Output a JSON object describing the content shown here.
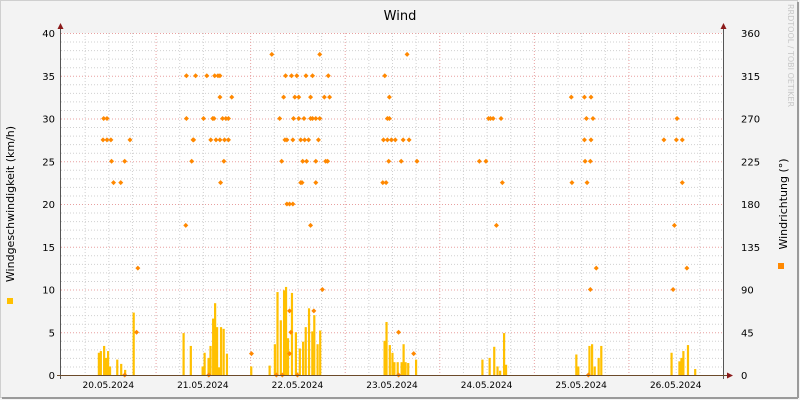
{
  "chart_data": {
    "type": "bar",
    "title": "Wind",
    "ylabel": "Windgeschwindigkeit (km/h)",
    "y2label": "Windrichtung (°)",
    "ylim": [
      0,
      40
    ],
    "y2lim": [
      0,
      360
    ],
    "yticks": [
      "0",
      "5",
      "10",
      "15",
      "20",
      "25",
      "30",
      "35",
      "40"
    ],
    "y2ticks": [
      "0",
      "45",
      "90",
      "135",
      "180",
      "225",
      "270",
      "315",
      "360"
    ],
    "xticks": [
      "20.05.2024",
      "21.05.2024",
      "22.05.2024",
      "23.05.2024",
      "24.05.2024",
      "25.05.2024",
      "26.05.2024"
    ],
    "xlim": [
      "20.05.2024 00:00",
      "27.05.2024 00:00"
    ],
    "grid": true,
    "watermark": "RRDTOOL / TOBI OETIKER",
    "colors": {
      "speed": "#ffc000",
      "direction": "#ff8800",
      "major_grid": "#e8a0a0",
      "minor_grid": "#d0d0d0",
      "axis": "#6b4a2a",
      "arrow": "#8b1a1a"
    },
    "series": [
      {
        "key": "speed",
        "axis": "left",
        "style": "step-bar",
        "points": [
          [
            "20.05.2024 09:20",
            2.6
          ],
          [
            "20.05.2024 09:50",
            2.8
          ],
          [
            "20.05.2024 10:40",
            3.4
          ],
          [
            "20.05.2024 11:10",
            2.0
          ],
          [
            "20.05.2024 11:40",
            2.8
          ],
          [
            "20.05.2024 12:10",
            1.0
          ],
          [
            "20.05.2024 14:00",
            1.8
          ],
          [
            "20.05.2024 15:00",
            1.3
          ],
          [
            "20.05.2024 16:00",
            0.6
          ],
          [
            "20.05.2024 18:10",
            7.3
          ],
          [
            "21.05.2024 06:50",
            4.9
          ],
          [
            "21.05.2024 08:40",
            3.4
          ],
          [
            "21.05.2024 11:40",
            1.0
          ],
          [
            "21.05.2024 12:10",
            2.6
          ],
          [
            "21.05.2024 13:10",
            2.0
          ],
          [
            "21.05.2024 13:40",
            3.4
          ],
          [
            "21.05.2024 14:20",
            6.6
          ],
          [
            "21.05.2024 14:50",
            8.4
          ],
          [
            "21.05.2024 15:20",
            5.6
          ],
          [
            "21.05.2024 15:50",
            0.9
          ],
          [
            "21.05.2024 16:20",
            5.6
          ],
          [
            "21.05.2024 17:00",
            5.4
          ],
          [
            "21.05.2024 17:50",
            2.5
          ],
          [
            "22.05.2024 00:00",
            1.0
          ],
          [
            "22.05.2024 04:40",
            1.1
          ],
          [
            "22.05.2024 06:00",
            3.6
          ],
          [
            "22.05.2024 06:40",
            9.7
          ],
          [
            "22.05.2024 07:30",
            6.4
          ],
          [
            "22.05.2024 08:20",
            9.9
          ],
          [
            "22.05.2024 08:50",
            10.3
          ],
          [
            "22.05.2024 09:20",
            4.3
          ],
          [
            "22.05.2024 10:20",
            9.6
          ],
          [
            "22.05.2024 11:20",
            5.0
          ],
          [
            "22.05.2024 12:20",
            3.1
          ],
          [
            "22.05.2024 13:10",
            3.9
          ],
          [
            "22.05.2024 13:50",
            5.6
          ],
          [
            "22.05.2024 14:40",
            7.8
          ],
          [
            "22.05.2024 15:30",
            5.1
          ],
          [
            "22.05.2024 16:00",
            7.0
          ],
          [
            "22.05.2024 16:50",
            3.6
          ],
          [
            "22.05.2024 17:30",
            5.2
          ],
          [
            "23.05.2024 09:50",
            4.0
          ],
          [
            "23.05.2024 10:20",
            6.2
          ],
          [
            "23.05.2024 11:10",
            3.5
          ],
          [
            "23.05.2024 11:50",
            2.6
          ],
          [
            "23.05.2024 12:20",
            1.5
          ],
          [
            "23.05.2024 13:10",
            1.5
          ],
          [
            "23.05.2024 14:10",
            1.5
          ],
          [
            "23.05.2024 14:40",
            3.6
          ],
          [
            "23.05.2024 15:10",
            1.5
          ],
          [
            "23.05.2024 15:50",
            1.4
          ],
          [
            "23.05.2024 17:50",
            1.8
          ],
          [
            "24.05.2024 10:40",
            1.8
          ],
          [
            "24.05.2024 12:30",
            2.0
          ],
          [
            "24.05.2024 13:40",
            3.3
          ],
          [
            "24.05.2024 14:30",
            1.0
          ],
          [
            "24.05.2024 15:10",
            0.5
          ],
          [
            "24.05.2024 16:10",
            4.9
          ],
          [
            "24.05.2024 16:40",
            1.2
          ],
          [
            "25.05.2024 10:30",
            2.4
          ],
          [
            "25.05.2024 11:00",
            1.0
          ],
          [
            "25.05.2024 13:50",
            3.4
          ],
          [
            "25.05.2024 14:30",
            3.6
          ],
          [
            "25.05.2024 15:10",
            1.0
          ],
          [
            "25.05.2024 16:10",
            2.0
          ],
          [
            "25.05.2024 16:50",
            3.4
          ],
          [
            "26.05.2024 10:40",
            2.6
          ],
          [
            "26.05.2024 12:40",
            1.6
          ],
          [
            "26.05.2024 13:10",
            2.0
          ],
          [
            "26.05.2024 13:40",
            2.8
          ],
          [
            "26.05.2024 14:50",
            3.5
          ],
          [
            "26.05.2024 16:40",
            0.7
          ]
        ]
      },
      {
        "key": "direction",
        "axis": "right",
        "style": "points",
        "points": [
          [
            "20.05.2024 10:50",
            270
          ],
          [
            "20.05.2024 11:40",
            270
          ],
          [
            "20.05.2024 10:40",
            247.5
          ],
          [
            "20.05.2024 11:40",
            247.5
          ],
          [
            "20.05.2024 12:40",
            247.5
          ],
          [
            "20.05.2024 17:30",
            247.5
          ],
          [
            "20.05.2024 12:50",
            225
          ],
          [
            "20.05.2024 16:10",
            225
          ],
          [
            "20.05.2024 13:20",
            202.5
          ],
          [
            "20.05.2024 15:10",
            202.5
          ],
          [
            "20.05.2024 19:30",
            112.5
          ],
          [
            "20.05.2024 19:10",
            45
          ],
          [
            "20.05.2024 16:10",
            0
          ],
          [
            "21.05.2024 07:40",
            157.5
          ],
          [
            "21.05.2024 07:50",
            315
          ],
          [
            "21.05.2024 10:10",
            315
          ],
          [
            "21.05.2024 13:00",
            315
          ],
          [
            "21.05.2024 15:00",
            315
          ],
          [
            "21.05.2024 15:50",
            315
          ],
          [
            "21.05.2024 16:20",
            315
          ],
          [
            "21.05.2024 16:20",
            292.5
          ],
          [
            "21.05.2024 19:20",
            292.5
          ],
          [
            "21.05.2024 07:50",
            270
          ],
          [
            "21.05.2024 12:10",
            270
          ],
          [
            "21.05.2024 14:30",
            270
          ],
          [
            "21.05.2024 14:50",
            270
          ],
          [
            "21.05.2024 17:00",
            270
          ],
          [
            "21.05.2024 17:50",
            270
          ],
          [
            "21.05.2024 18:30",
            270
          ],
          [
            "21.05.2024 09:30",
            247.5
          ],
          [
            "21.05.2024 09:40",
            247.5
          ],
          [
            "21.05.2024 14:00",
            247.5
          ],
          [
            "21.05.2024 15:20",
            247.5
          ],
          [
            "21.05.2024 16:20",
            247.5
          ],
          [
            "21.05.2024 17:30",
            247.5
          ],
          [
            "21.05.2024 18:30",
            247.5
          ],
          [
            "21.05.2024 09:10",
            225
          ],
          [
            "21.05.2024 17:20",
            225
          ],
          [
            "21.05.2024 16:30",
            202.5
          ],
          [
            "21.05.2024 13:30",
            0
          ],
          [
            "22.05.2024 00:20",
            22.5
          ],
          [
            "22.05.2024 05:30",
            337.5
          ],
          [
            "22.05.2024 17:40",
            337.5
          ],
          [
            "22.05.2024 09:00",
            315
          ],
          [
            "22.05.2024 10:30",
            315
          ],
          [
            "22.05.2024 11:50",
            315
          ],
          [
            "22.05.2024 14:10",
            315
          ],
          [
            "22.05.2024 15:50",
            315
          ],
          [
            "22.05.2024 19:50",
            315
          ],
          [
            "22.05.2024 08:30",
            292.5
          ],
          [
            "22.05.2024 11:20",
            292.5
          ],
          [
            "22.05.2024 12:20",
            292.5
          ],
          [
            "22.05.2024 15:20",
            292.5
          ],
          [
            "22.05.2024 18:50",
            292.5
          ],
          [
            "22.05.2024 20:10",
            292.5
          ],
          [
            "22.05.2024 07:30",
            270
          ],
          [
            "22.05.2024 11:00",
            270
          ],
          [
            "22.05.2024 12:20",
            270
          ],
          [
            "22.05.2024 13:40",
            270
          ],
          [
            "22.05.2024 15:20",
            270
          ],
          [
            "22.05.2024 15:50",
            270
          ],
          [
            "22.05.2024 16:40",
            270
          ],
          [
            "22.05.2024 17:40",
            270
          ],
          [
            "22.05.2024 08:50",
            247.5
          ],
          [
            "22.05.2024 09:20",
            247.5
          ],
          [
            "22.05.2024 10:50",
            247.5
          ],
          [
            "22.05.2024 12:50",
            247.5
          ],
          [
            "22.05.2024 13:50",
            247.5
          ],
          [
            "22.05.2024 14:50",
            247.5
          ],
          [
            "22.05.2024 17:20",
            247.5
          ],
          [
            "22.05.2024 08:00",
            225
          ],
          [
            "22.05.2024 13:20",
            225
          ],
          [
            "22.05.2024 14:20",
            225
          ],
          [
            "22.05.2024 16:40",
            225
          ],
          [
            "22.05.2024 19:10",
            225
          ],
          [
            "22.05.2024 19:40",
            225
          ],
          [
            "22.05.2024 12:50",
            202.5
          ],
          [
            "22.05.2024 13:10",
            202.5
          ],
          [
            "22.05.2024 16:40",
            202.5
          ],
          [
            "22.05.2024 09:20",
            180
          ],
          [
            "22.05.2024 10:00",
            180
          ],
          [
            "22.05.2024 10:50",
            180
          ],
          [
            "22.05.2024 15:20",
            157.5
          ],
          [
            "22.05.2024 18:20",
            90
          ],
          [
            "22.05.2024 10:00",
            67.5
          ],
          [
            "22.05.2024 16:10",
            67.5
          ],
          [
            "22.05.2024 10:20",
            45
          ],
          [
            "22.05.2024 10:00",
            22.5
          ],
          [
            "22.05.2024 06:40",
            0
          ],
          [
            "22.05.2024 08:10",
            0
          ],
          [
            "22.05.2024 12:00",
            0
          ],
          [
            "23.05.2024 15:50",
            337.5
          ],
          [
            "23.05.2024 10:10",
            315
          ],
          [
            "23.05.2024 11:20",
            292.5
          ],
          [
            "23.05.2024 10:50",
            270
          ],
          [
            "23.05.2024 11:20",
            270
          ],
          [
            "23.05.2024 09:50",
            247.5
          ],
          [
            "23.05.2024 10:50",
            247.5
          ],
          [
            "23.05.2024 11:50",
            247.5
          ],
          [
            "23.05.2024 12:50",
            247.5
          ],
          [
            "23.05.2024 14:50",
            247.5
          ],
          [
            "23.05.2024 16:20",
            247.5
          ],
          [
            "23.05.2024 11:10",
            225
          ],
          [
            "23.05.2024 14:20",
            225
          ],
          [
            "23.05.2024 18:20",
            225
          ],
          [
            "23.05.2024 09:40",
            202.5
          ],
          [
            "23.05.2024 10:30",
            202.5
          ],
          [
            "23.05.2024 13:40",
            45
          ],
          [
            "23.05.2024 17:30",
            22.5
          ],
          [
            "23.05.2024 13:40",
            0
          ],
          [
            "24.05.2024 12:30",
            270
          ],
          [
            "24.05.2024 13:00",
            270
          ],
          [
            "24.05.2024 13:40",
            270
          ],
          [
            "24.05.2024 15:40",
            270
          ],
          [
            "24.05.2024 10:10",
            225
          ],
          [
            "24.05.2024 11:50",
            225
          ],
          [
            "24.05.2024 16:00",
            202.5
          ],
          [
            "24.05.2024 14:30",
            157.5
          ],
          [
            "25.05.2024 09:30",
            292.5
          ],
          [
            "25.05.2024 12:50",
            292.5
          ],
          [
            "25.05.2024 14:30",
            292.5
          ],
          [
            "25.05.2024 13:20",
            270
          ],
          [
            "25.05.2024 15:00",
            270
          ],
          [
            "25.05.2024 12:50",
            247.5
          ],
          [
            "25.05.2024 14:30",
            247.5
          ],
          [
            "25.05.2024 13:00",
            225
          ],
          [
            "25.05.2024 14:20",
            225
          ],
          [
            "25.05.2024 09:40",
            202.5
          ],
          [
            "25.05.2024 13:30",
            202.5
          ],
          [
            "25.05.2024 15:50",
            112.5
          ],
          [
            "25.05.2024 14:20",
            90
          ],
          [
            "25.05.2024 13:50",
            0
          ],
          [
            "26.05.2024 09:00",
            247.5
          ],
          [
            "26.05.2024 12:10",
            247.5
          ],
          [
            "26.05.2024 13:40",
            247.5
          ],
          [
            "26.05.2024 12:20",
            270
          ],
          [
            "26.05.2024 13:40",
            202.5
          ],
          [
            "26.05.2024 11:40",
            157.5
          ],
          [
            "26.05.2024 14:50",
            112.5
          ],
          [
            "26.05.2024 11:20",
            90
          ]
        ]
      }
    ]
  }
}
